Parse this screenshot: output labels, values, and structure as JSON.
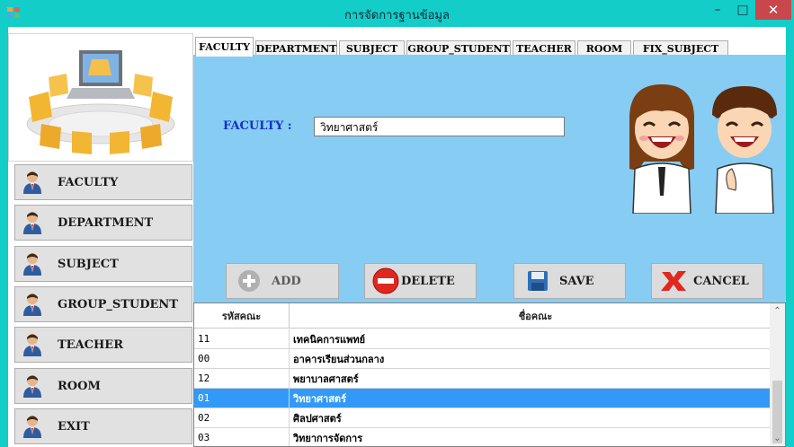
{
  "window": {
    "title": "การจัดการฐานข้อมูล",
    "minimize_icon": "minimize-icon",
    "maximize_icon": "maximize-icon",
    "close_icon": "close-icon",
    "frame_color": "#13cdc8",
    "close_color": "#c9464c"
  },
  "sidebar": {
    "logo_icon": "folders-laptop-icon",
    "items": [
      {
        "label": "FACULTY",
        "icon": "user-icon"
      },
      {
        "label": "DEPARTMENT",
        "icon": "user-icon"
      },
      {
        "label": "SUBJECT",
        "icon": "user-icon"
      },
      {
        "label": "GROUP_STUDENT",
        "icon": "user-icon"
      },
      {
        "label": "TEACHER",
        "icon": "user-icon"
      },
      {
        "label": "ROOM",
        "icon": "user-icon"
      },
      {
        "label": "EXIT",
        "icon": "user-icon"
      }
    ]
  },
  "tabs": [
    {
      "label": "FACULTY",
      "active": true
    },
    {
      "label": "DEPARTMENT",
      "active": false
    },
    {
      "label": "SUBJECT",
      "active": false
    },
    {
      "label": "GROUP_STUDENT",
      "active": false
    },
    {
      "label": "TEACHER",
      "active": false
    },
    {
      "label": "ROOM",
      "active": false
    },
    {
      "label": "FIX_SUBJECT",
      "active": false
    }
  ],
  "form": {
    "faculty_label": "FACULTY :",
    "faculty_value": "วิทยาศาสตร์",
    "panel_color": "#87ccf3",
    "mascot_icon": "students-mascot-icon"
  },
  "actions": {
    "add": {
      "label": "ADD",
      "icon": "plus-circle-icon",
      "enabled": false
    },
    "delete": {
      "label": "DELETE",
      "icon": "minus-circle-icon",
      "enabled": true
    },
    "save": {
      "label": "SAVE",
      "icon": "floppy-disk-icon",
      "enabled": true
    },
    "cancel": {
      "label": "CANCEL",
      "icon": "x-mark-icon",
      "enabled": true
    }
  },
  "grid": {
    "columns": [
      "รหัสคณะ",
      "ชื่อคณะ"
    ],
    "rows": [
      {
        "code": "11",
        "name": "เทคนิคการแพทย์"
      },
      {
        "code": "00",
        "name": "อาคารเรียนส่วนกลาง"
      },
      {
        "code": "12",
        "name": "พยาบาลศาสตร์"
      },
      {
        "code": "01",
        "name": "วิทยาศาสตร์",
        "selected": true
      },
      {
        "code": "02",
        "name": "ศิลปศาสตร์"
      },
      {
        "code": "03",
        "name": "วิทยาการจัดการ"
      }
    ],
    "selection_color": "#3399f6"
  }
}
